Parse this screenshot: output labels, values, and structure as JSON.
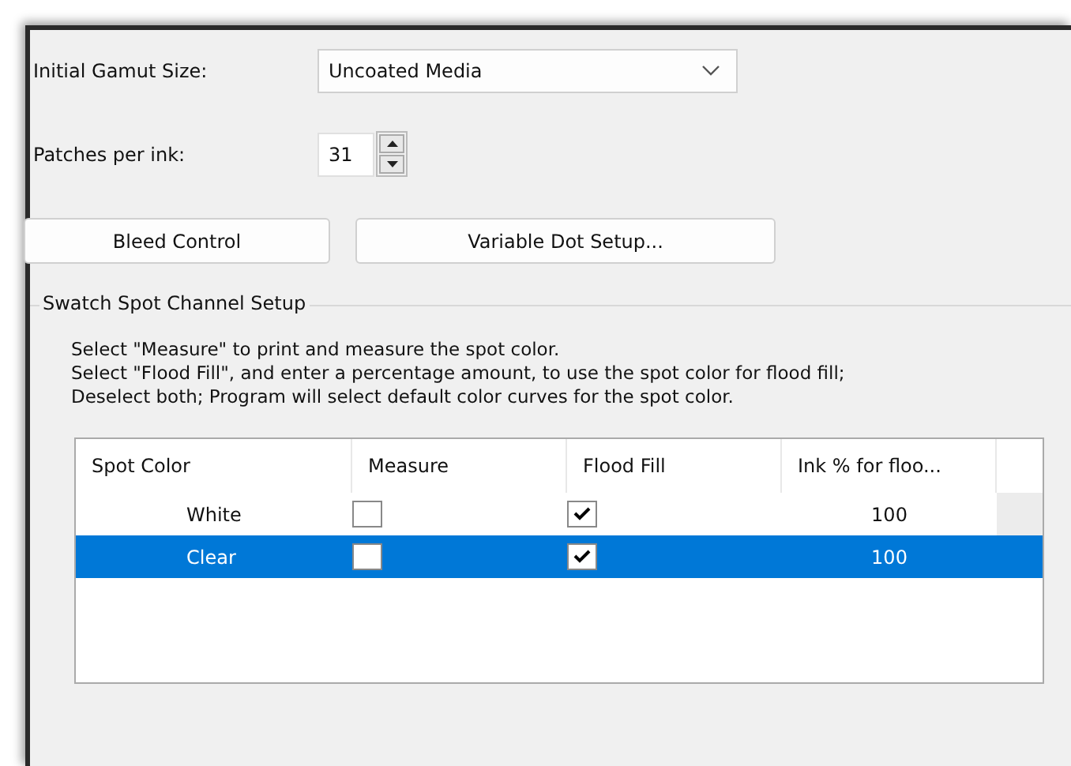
{
  "gamut": {
    "label": "Initial Gamut Size:",
    "value": "Uncoated Media"
  },
  "patches": {
    "label": "Patches per ink:",
    "value": "31"
  },
  "buttons": [
    "Bleed Control",
    "Variable Dot Setup..."
  ],
  "group": {
    "title": "Swatch Spot Channel Setup",
    "instructions": [
      "Select \"Measure\" to print and measure the spot color.",
      "Select \"Flood Fill\", and enter a percentage amount, to use the spot color for flood fill;",
      "Deselect both; Program will select default color curves for the spot color."
    ],
    "table": {
      "columns": [
        "Spot Color",
        "Measure",
        "Flood Fill",
        "Ink % for floo..."
      ],
      "rows": [
        {
          "spot_color": "White",
          "measure": false,
          "flood_fill": true,
          "ink": "100",
          "selected": false
        },
        {
          "spot_color": "Clear",
          "measure": false,
          "flood_fill": true,
          "ink": "100",
          "selected": true
        }
      ]
    }
  }
}
